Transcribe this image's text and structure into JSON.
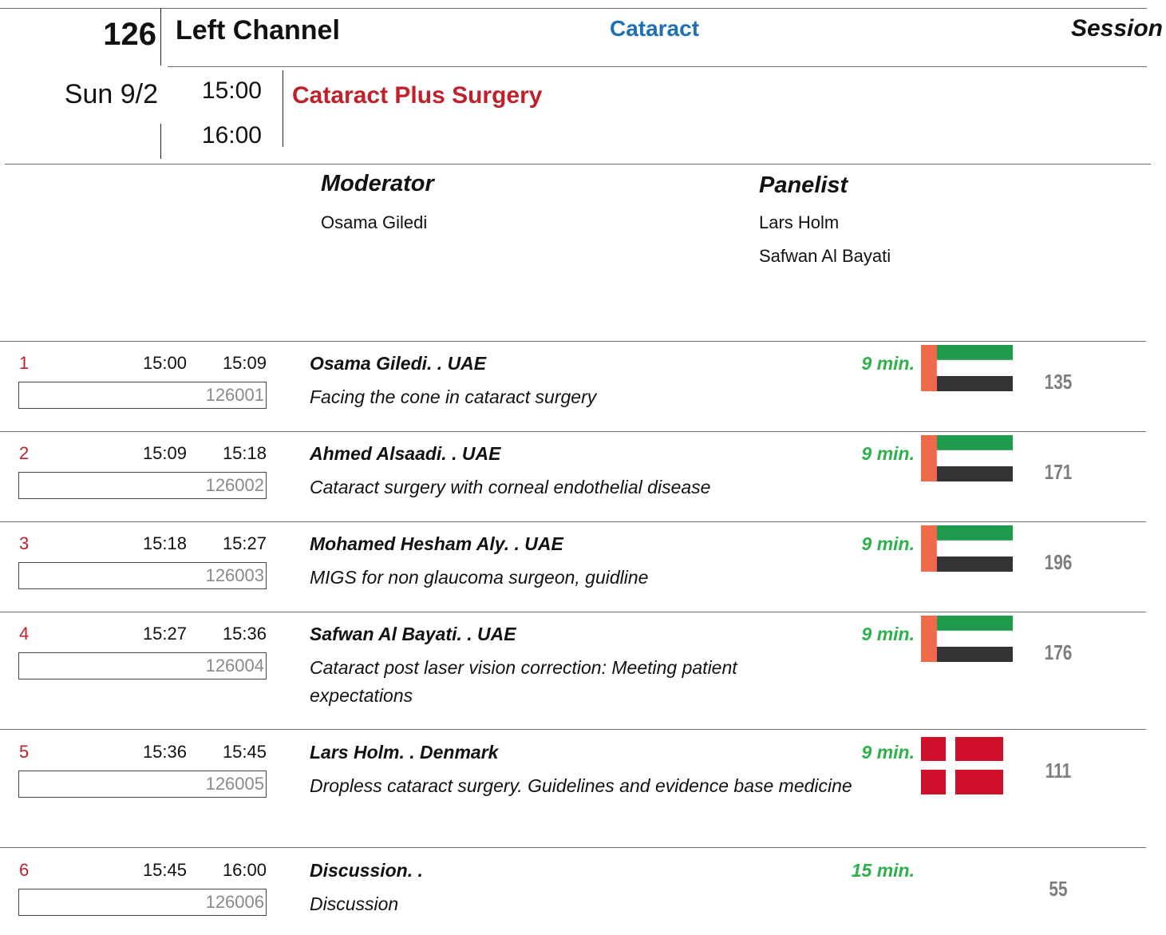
{
  "header": {
    "session_number": "126",
    "channel": "Left Channel",
    "topic": "Cataract",
    "session_label": "Session",
    "date": "Sun 9/2",
    "start_time": "15:00",
    "end_time": "16:00",
    "session_title": "Cataract Plus Surgery"
  },
  "roles": {
    "moderator_label": "Moderator",
    "moderators": [
      "Osama Giledi"
    ],
    "panelist_label": "Panelist",
    "panelists": [
      "Lars Holm",
      "Safwan Al Bayati"
    ]
  },
  "colors": {
    "topic": "#1f6fb5",
    "title": "#c0202a",
    "duration": "#2db14a",
    "count": "#7d7d7d"
  },
  "talks": [
    {
      "index": "1",
      "start": "15:00",
      "end": "15:09",
      "code": "126001",
      "speaker": "Osama Giledi. . UAE",
      "topic": "Facing the cone in cataract surgery",
      "duration": "9 min.",
      "flag": "uae-flag",
      "count": "135"
    },
    {
      "index": "2",
      "start": "15:09",
      "end": "15:18",
      "code": "126002",
      "speaker": "Ahmed Alsaadi. . UAE",
      "topic": "Cataract surgery with corneal endothelial disease",
      "duration": "9 min.",
      "flag": "uae-flag",
      "count": "171"
    },
    {
      "index": "3",
      "start": "15:18",
      "end": "15:27",
      "code": "126003",
      "speaker": "Mohamed Hesham Aly. . UAE",
      "topic": "MIGS for non glaucoma surgeon, guidline",
      "duration": "9 min.",
      "flag": "uae-flag",
      "count": "196"
    },
    {
      "index": "4",
      "start": "15:27",
      "end": "15:36",
      "code": "126004",
      "speaker": "Safwan Al Bayati. . UAE",
      "topic": "Cataract post laser vision correction: Meeting patient expectations",
      "duration": "9 min.",
      "flag": "uae-flag",
      "count": "176"
    },
    {
      "index": "5",
      "start": "15:36",
      "end": "15:45",
      "code": "126005",
      "speaker": "Lars Holm. . Denmark",
      "topic": "Dropless cataract surgery. Guidelines and evidence base medicine",
      "duration": "9 min.",
      "flag": "denmark-flag",
      "count": "111"
    },
    {
      "index": "6",
      "start": "15:45",
      "end": "16:00",
      "code": "126006",
      "speaker": "Discussion. .",
      "topic": "Discussion",
      "duration": "15 min.",
      "flag": "",
      "count": "55"
    }
  ]
}
